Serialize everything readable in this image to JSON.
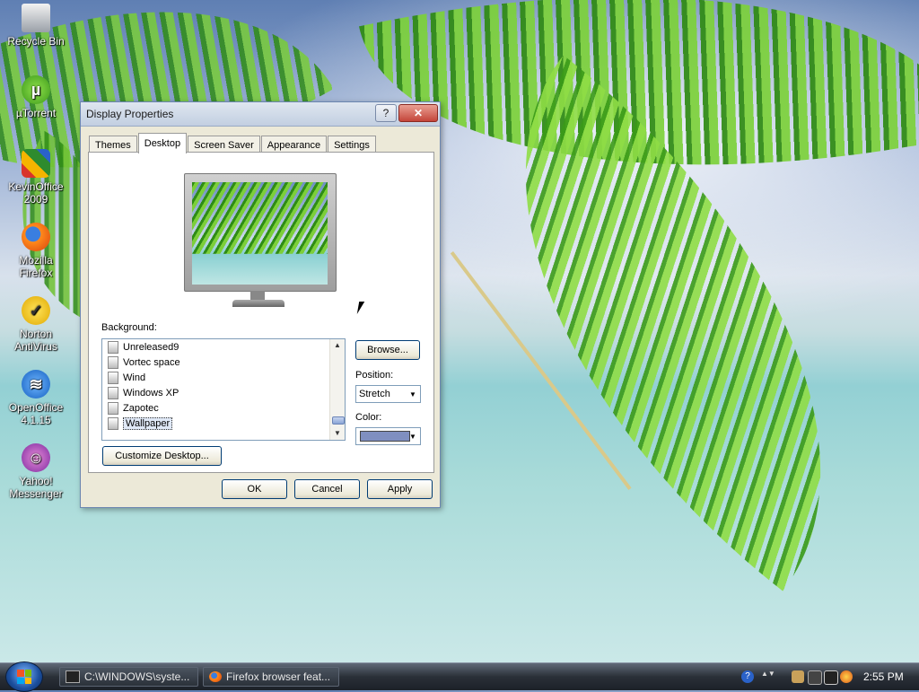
{
  "desktop": {
    "icons": [
      {
        "label": "Recycle Bin",
        "icon": "recycle-bin-icon"
      },
      {
        "label": "µTorrent",
        "icon": "utorrent-icon"
      },
      {
        "label": "KevinOffice 2009",
        "icon": "kevinoffice-icon"
      },
      {
        "label": "Mozilla Firefox",
        "icon": "firefox-icon"
      },
      {
        "label": "Norton AntiVirus",
        "icon": "norton-icon"
      },
      {
        "label": "OpenOffice 4.1.15",
        "icon": "openoffice-icon"
      },
      {
        "label": "Yahoo! Messenger",
        "icon": "yahoo-messenger-icon"
      }
    ]
  },
  "dialog": {
    "title": "Display Properties",
    "help_glyph": "?",
    "close_glyph": "✕",
    "tabs": [
      {
        "label": "Themes",
        "active": false
      },
      {
        "label": "Desktop",
        "active": true
      },
      {
        "label": "Screen Saver",
        "active": false
      },
      {
        "label": "Appearance",
        "active": false
      },
      {
        "label": "Settings",
        "active": false
      }
    ],
    "background_label": "Background:",
    "backgrounds": [
      {
        "label": "Unreleased9",
        "selected": false
      },
      {
        "label": "Vortec space",
        "selected": false
      },
      {
        "label": "Wind",
        "selected": false
      },
      {
        "label": "Windows XP",
        "selected": false
      },
      {
        "label": "Zapotec",
        "selected": false
      },
      {
        "label": "Wallpaper",
        "selected": true
      }
    ],
    "browse_label": "Browse...",
    "position_label": "Position:",
    "position_value": "Stretch",
    "color_label": "Color:",
    "color_value": "#7f8fc0",
    "customize_label": "Customize Desktop...",
    "ok_label": "OK",
    "cancel_label": "Cancel",
    "apply_label": "Apply"
  },
  "taskbar": {
    "items": [
      {
        "label": "C:\\WINDOWS\\syste...",
        "icon": "console-icon"
      },
      {
        "label": "Firefox browser feat...",
        "icon": "firefox-icon"
      }
    ],
    "clock": "2:55 PM"
  }
}
